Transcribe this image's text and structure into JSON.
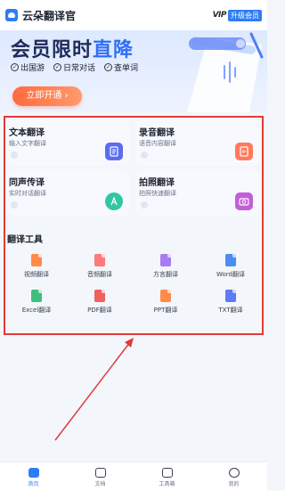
{
  "app": {
    "title": "云朵翻译官"
  },
  "vip": {
    "mark": "VIP",
    "badge": "升级会员"
  },
  "banner": {
    "title_main": "会员限时",
    "title_highlight": "直降",
    "features": [
      "出国游",
      "日常对话",
      "查单词"
    ],
    "cta_label": "立即开通 ›"
  },
  "cards": [
    {
      "title": "文本翻译",
      "subtitle": "输入文字翻译",
      "icon": "document-icon",
      "icon_color": "#5b6cf0"
    },
    {
      "title": "录音翻译",
      "subtitle": "语音内容翻译",
      "icon": "audio-file-icon",
      "icon_color": "#ff7a5c"
    },
    {
      "title": "同声传译",
      "subtitle": "实时对话翻译",
      "icon": "translate-a-icon",
      "icon_color": "#2fc7a0"
    },
    {
      "title": "拍照翻译",
      "subtitle": "拍照快速翻译",
      "icon": "camera-icon",
      "icon_color": "#c25fd6"
    }
  ],
  "tools": {
    "title": "翻译工具",
    "items": [
      {
        "label": "视频翻译",
        "color": "#ff8a4c"
      },
      {
        "label": "音频翻译",
        "color": "#ff7a7a"
      },
      {
        "label": "方言翻译",
        "color": "#a77cf5"
      },
      {
        "label": "Word翻译",
        "color": "#4d8cf5"
      },
      {
        "label": "Excel翻译",
        "color": "#3fbf7f"
      },
      {
        "label": "PDF翻译",
        "color": "#f25f5f"
      },
      {
        "label": "PPT翻译",
        "color": "#ff8a4c"
      },
      {
        "label": "TXT翻译",
        "color": "#5b7cf5"
      }
    ]
  },
  "nav": {
    "items": [
      {
        "label": "首页",
        "active": true
      },
      {
        "label": "文档"
      },
      {
        "label": "工具箱"
      },
      {
        "label": "我的"
      }
    ]
  },
  "colors": {
    "accent": "#2f7df6",
    "cta": "#ff6a3d",
    "annotation": "#e23a3a"
  }
}
